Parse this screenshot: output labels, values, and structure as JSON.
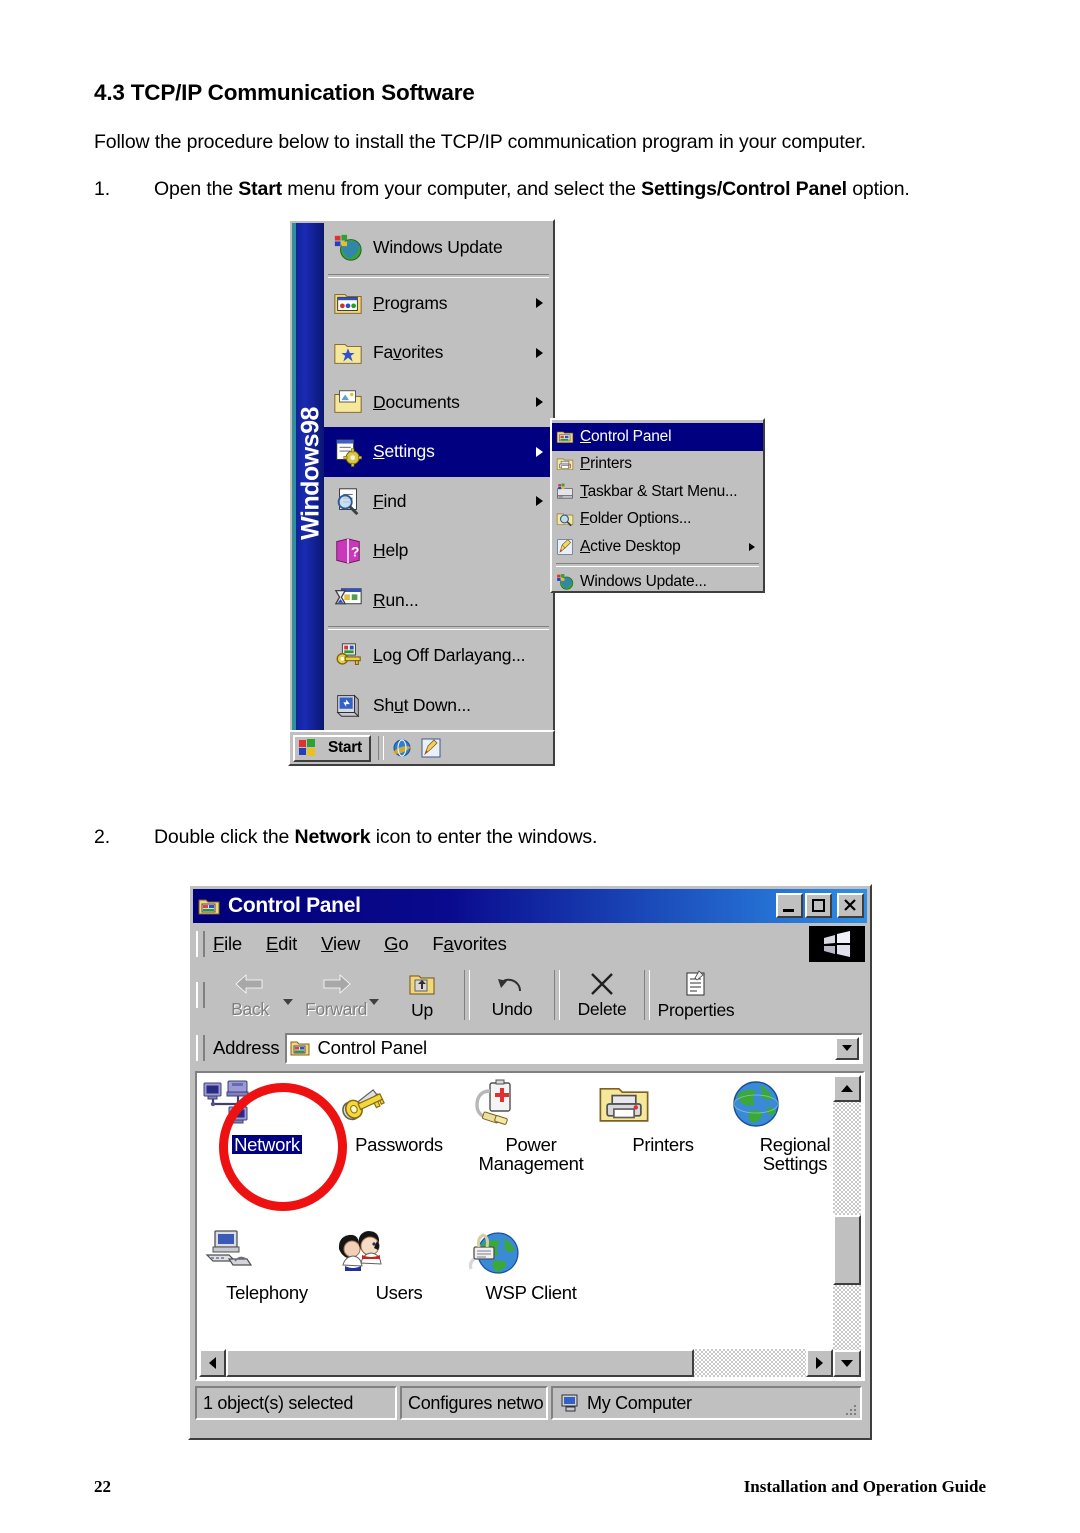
{
  "document": {
    "heading": "4.3 TCP/IP Communication Software",
    "intro": "Follow the procedure below to install the TCP/IP communication program in your computer.",
    "steps": [
      {
        "number": "1.",
        "text_parts": [
          "Open the ",
          "Start",
          " menu from your computer, and select the ",
          "Settings/Control Panel",
          " option."
        ]
      },
      {
        "number": "2.",
        "text_parts": [
          "Double click the ",
          "Network",
          " icon to enter the windows."
        ]
      }
    ],
    "footer": {
      "page_number": "22",
      "guide_title": "Installation and Operation Guide"
    }
  },
  "start_menu": {
    "banner_text": "Windows98",
    "items": [
      {
        "label": "Windows Update",
        "icon": "windows-update-icon",
        "accel": "",
        "has_submenu": false,
        "selected": false,
        "separator_after": true
      },
      {
        "label": "Programs",
        "icon": "programs-folder-icon",
        "accel": "P",
        "has_submenu": true,
        "selected": false,
        "separator_after": false
      },
      {
        "label": "Favorites",
        "icon": "favorites-folder-icon",
        "accel": "v",
        "has_submenu": true,
        "selected": false,
        "separator_after": false
      },
      {
        "label": "Documents",
        "icon": "documents-folder-icon",
        "accel": "D",
        "has_submenu": true,
        "selected": false,
        "separator_after": false
      },
      {
        "label": "Settings",
        "icon": "settings-gear-icon",
        "accel": "S",
        "has_submenu": true,
        "selected": true,
        "separator_after": false
      },
      {
        "label": "Find",
        "icon": "find-magnifier-icon",
        "accel": "F",
        "has_submenu": true,
        "selected": false,
        "separator_after": false
      },
      {
        "label": "Help",
        "icon": "help-book-icon",
        "accel": "H",
        "has_submenu": false,
        "selected": false,
        "separator_after": false
      },
      {
        "label": "Run...",
        "icon": "run-hourglass-icon",
        "accel": "R",
        "has_submenu": false,
        "selected": false,
        "separator_after": true
      },
      {
        "label": "Log Off Darlayang...",
        "icon": "logoff-key-icon",
        "accel": "L",
        "has_submenu": false,
        "selected": false,
        "separator_after": false
      },
      {
        "label": "Shut Down...",
        "icon": "shutdown-icon",
        "accel": "u",
        "has_submenu": false,
        "selected": false,
        "separator_after": false
      }
    ],
    "submenu": {
      "items": [
        {
          "label": "Control Panel",
          "icon": "control-panel-icon",
          "accel": "C",
          "has_submenu": false,
          "selected": true,
          "separator_after": false
        },
        {
          "label": "Printers",
          "icon": "printers-folder-icon",
          "accel": "P",
          "has_submenu": false,
          "selected": false,
          "separator_after": false
        },
        {
          "label": "Taskbar & Start Menu...",
          "icon": "taskbar-icon",
          "accel": "T",
          "has_submenu": false,
          "selected": false,
          "separator_after": false
        },
        {
          "label": "Folder Options...",
          "icon": "folder-options-icon",
          "accel": "F",
          "has_submenu": false,
          "selected": false,
          "separator_after": false
        },
        {
          "label": "Active Desktop",
          "icon": "active-desktop-icon",
          "accel": "A",
          "has_submenu": true,
          "selected": false,
          "separator_after": true
        },
        {
          "label": "Windows Update...",
          "icon": "windows-update-icon",
          "accel": "",
          "has_submenu": false,
          "selected": false,
          "separator_after": false
        }
      ]
    },
    "taskbar": {
      "start_label": "Start",
      "quick_launch": [
        "internet-explorer-icon",
        "notepad-pencil-icon"
      ]
    }
  },
  "control_panel": {
    "title": "Control Panel",
    "window_buttons": [
      "minimize-button",
      "maximize-button",
      "close-button"
    ],
    "menus": [
      {
        "label": "File",
        "accel": "F"
      },
      {
        "label": "Edit",
        "accel": "E"
      },
      {
        "label": "View",
        "accel": "V"
      },
      {
        "label": "Go",
        "accel": "G"
      },
      {
        "label": "Favorites",
        "accel": "a"
      }
    ],
    "toolbar": [
      {
        "label": "Back",
        "icon": "back-arrow-icon",
        "disabled": true,
        "dropdown": true
      },
      {
        "label": "Forward",
        "icon": "forward-arrow-icon",
        "disabled": true,
        "dropdown": true
      },
      {
        "label": "Up",
        "icon": "up-folder-icon",
        "disabled": false,
        "dropdown": false
      },
      {
        "label": "Undo",
        "icon": "undo-arrow-icon",
        "disabled": false,
        "dropdown": false
      },
      {
        "label": "Delete",
        "icon": "delete-x-icon",
        "disabled": false,
        "dropdown": false
      },
      {
        "label": "Properties",
        "icon": "properties-icon",
        "disabled": false,
        "dropdown": false
      }
    ],
    "address": {
      "label": "Address",
      "value": "Control Panel",
      "icon": "control-panel-icon"
    },
    "icons": [
      {
        "label": "Network",
        "icon": "network-icon",
        "selected": true,
        "annotated": true
      },
      {
        "label": "Passwords",
        "icon": "passwords-key-icon",
        "selected": false,
        "annotated": false
      },
      {
        "label": "Power Management",
        "icon": "power-management-icon",
        "selected": false,
        "annotated": false
      },
      {
        "label": "Printers",
        "icon": "printers-folder-icon",
        "selected": false,
        "annotated": false
      },
      {
        "label": "Regional Settings",
        "icon": "regional-settings-globe-icon",
        "selected": false,
        "annotated": false
      },
      {
        "label": "Telephony",
        "icon": "telephony-icon",
        "selected": false,
        "annotated": false
      },
      {
        "label": "Users",
        "icon": "users-icon",
        "selected": false,
        "annotated": false
      },
      {
        "label": "WSP Client",
        "icon": "wsp-client-icon",
        "selected": false,
        "annotated": false
      }
    ],
    "status_bar": {
      "selection": "1 object(s) selected",
      "description": "Configures netwo",
      "zone": "My Computer",
      "zone_icon": "my-computer-icon"
    }
  },
  "colors": {
    "face": "#c0c0c0",
    "highlight": "#000080",
    "title_gradient_start": "#00007a",
    "title_gradient_end": "#2d8fe8",
    "annotation_red": "#ee1111",
    "disabled_text": "#808080"
  }
}
